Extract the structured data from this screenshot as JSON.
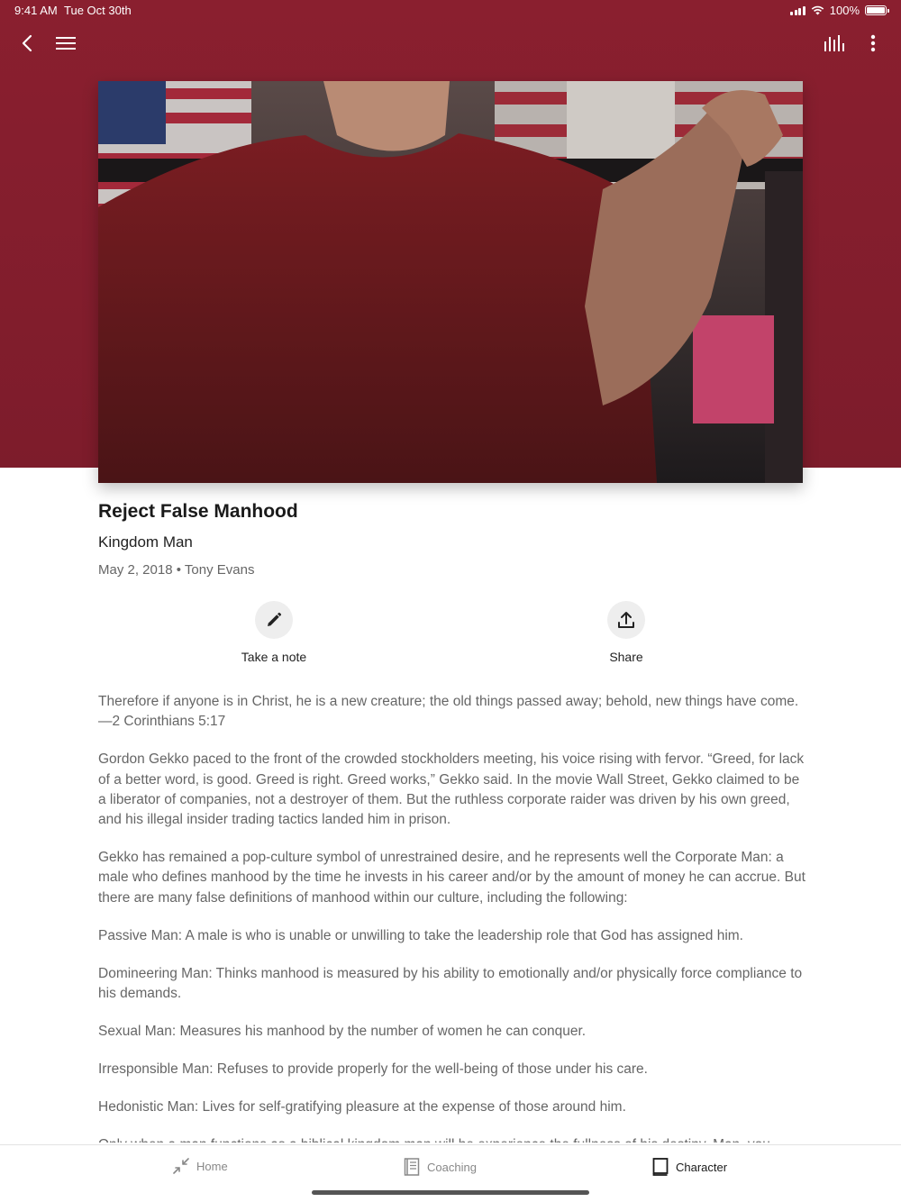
{
  "status_bar": {
    "time": "9:41 AM",
    "date": "Tue Oct 30th",
    "battery": "100%"
  },
  "toolbar": {
    "back_icon": "chevron-left-icon",
    "menu_icon": "hamburger-icon",
    "audio_icon": "audio-bars-icon",
    "more_icon": "more-vertical-icon"
  },
  "colors": {
    "header_bg": "#8a1f2f",
    "text_muted": "#666666"
  },
  "article": {
    "title": "Reject False Manhood",
    "series": "Kingdom Man",
    "date": "May 2, 2018",
    "separator": "•",
    "author": "Tony Evans",
    "paragraphs": [
      "Therefore if anyone is in Christ, he is a new creature; the old things passed away; behold, new things have come. —2 Corinthians 5:17",
      "Gordon Gekko paced to the front of the crowded stockholders meeting, his voice rising with fervor. “Greed, for lack of a better word, is good. Greed is right. Greed works,” Gekko said. In the movie Wall Street, Gekko claimed to be a liberator of companies, not a destroyer of them. But the ruthless corporate raider was driven by his own greed, and his illegal insider trading tactics landed him in prison.",
      "Gekko has remained a pop-culture symbol of unrestrained desire, and he represents well the Corporate Man: a male who defines manhood by the time he invests in his career and/or by the amount of money he can accrue. But there are many false definitions of manhood within our culture, including the following:",
      "Passive Man: A male is who is unable or unwilling to take the leadership role that God has assigned him.",
      "Domineering Man: Thinks manhood is measured by his ability to emotionally and/or physically force compliance to his demands.",
      "Sexual Man: Measures his manhood by the number of women he can conquer.",
      "Irresponsible Man: Refuses to provide properly for the well-being of those under his care.",
      "Hedonistic Man: Lives for self-gratifying pleasure at the expense of those around him.",
      "Only when a man functions as a biblical kingdom man will he experience the fullness of his destiny. Man, you"
    ]
  },
  "actions": {
    "note": {
      "label": "Take a note",
      "icon": "pencil-icon"
    },
    "share": {
      "label": "Share",
      "icon": "share-icon"
    }
  },
  "tabs": [
    {
      "label": "Home",
      "icon": "collapse-arrows-icon",
      "active": false
    },
    {
      "label": "Coaching",
      "icon": "document-icon",
      "active": false
    },
    {
      "label": "Character",
      "icon": "book-icon",
      "active": true
    }
  ]
}
